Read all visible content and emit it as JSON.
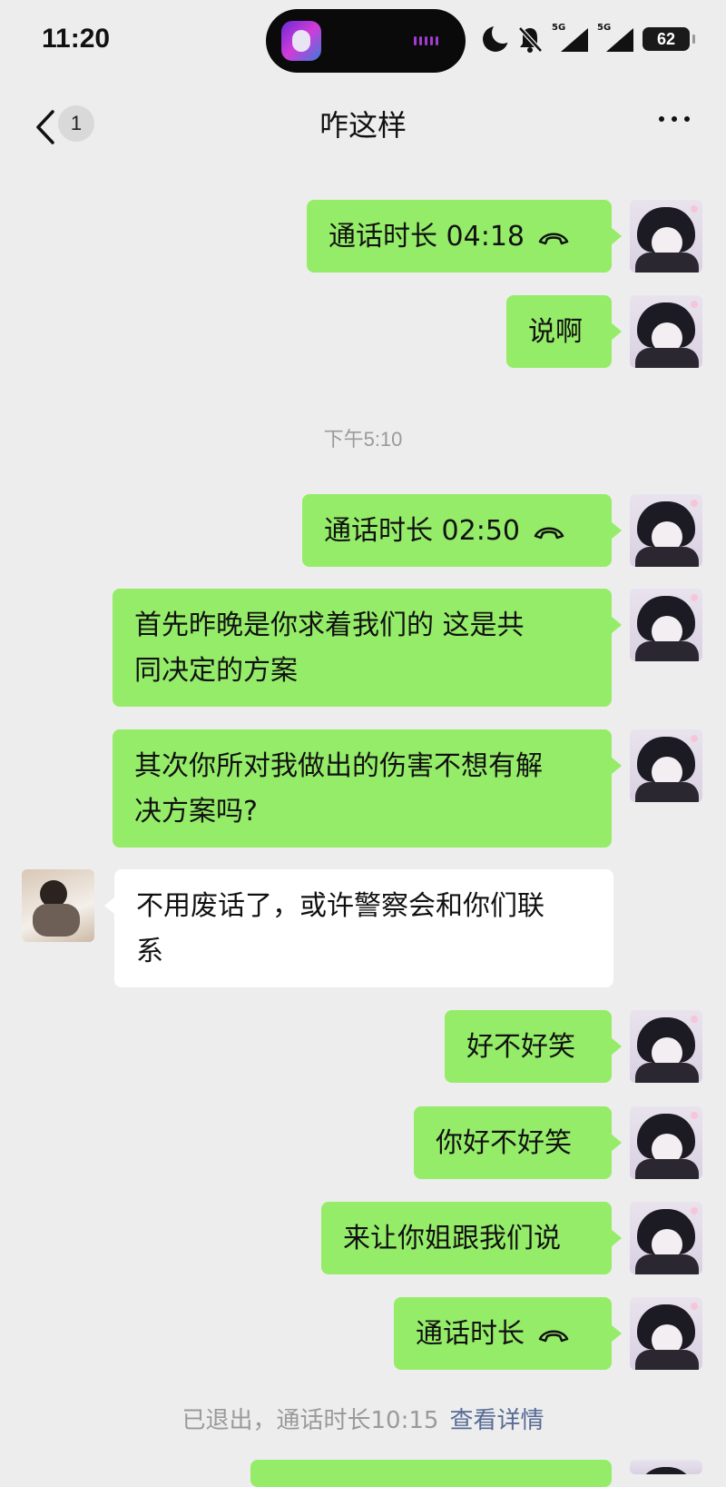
{
  "status_bar": {
    "time": "11:20",
    "battery": "62",
    "network": "5G"
  },
  "header": {
    "back_badge": "1",
    "title": "咋这样"
  },
  "timestamps": [
    "下午5:10"
  ],
  "messages": [
    {
      "side": "out",
      "text": "通话时长 04:18",
      "call": true
    },
    {
      "side": "out",
      "text": "说啊"
    },
    {
      "side": "out",
      "text": "通话时长 02:50",
      "call": true
    },
    {
      "side": "out",
      "lines": [
        "首先昨晚是你求着我们的 这是共",
        "同决定的方案"
      ]
    },
    {
      "side": "out",
      "lines": [
        "其次你所对我做出的伤害不想有解",
        "决方案吗?"
      ]
    },
    {
      "side": "in",
      "lines": [
        "不用废话了，或许警察会和你们联",
        "系"
      ]
    },
    {
      "side": "out",
      "text": "好不好笑"
    },
    {
      "side": "out",
      "text": "你好不好笑"
    },
    {
      "side": "out",
      "text": "来让你姐跟我们说"
    },
    {
      "side": "out",
      "text": "通话时长",
      "call": true
    }
  ],
  "system": {
    "text": "已退出，通话时长10:15",
    "link": "查看详情"
  },
  "colors": {
    "bubble_out": "#95ec69",
    "bubble_in": "#ffffff",
    "background": "#ededed",
    "link": "#576b95"
  }
}
